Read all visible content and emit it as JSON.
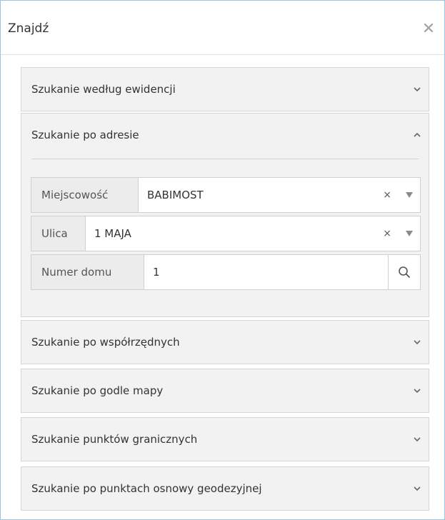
{
  "dialog": {
    "title": "Znajdź",
    "close_icon": "close-icon"
  },
  "panels": [
    {
      "title": "Szukanie według ewidencji",
      "state": "collapsed",
      "icon": "chevron-down-icon"
    },
    {
      "title": "Szukanie po adresie",
      "state": "expanded",
      "icon": "chevron-up-icon"
    },
    {
      "title": "Szukanie po współrzędnych",
      "state": "collapsed",
      "icon": "chevron-down-icon"
    },
    {
      "title": "Szukanie po godle mapy",
      "state": "collapsed",
      "icon": "chevron-down-icon"
    },
    {
      "title": "Szukanie punktów granicznych",
      "state": "collapsed",
      "icon": "chevron-down-icon"
    },
    {
      "title": "Szukanie po punktach osnowy geodezyjnej",
      "state": "collapsed",
      "icon": "chevron-down-icon"
    }
  ],
  "address_form": {
    "city": {
      "label": "Miejscowość",
      "value": "BABIMOST",
      "clear": "×"
    },
    "street": {
      "label": "Ulica",
      "value": "1 MAJA",
      "clear": "×"
    },
    "house_number": {
      "label": "Numer domu",
      "value": "1",
      "search_icon": "search-icon"
    }
  },
  "colors": {
    "dialog_border": "#9ec3df",
    "panel_bg": "#f2f2f2",
    "label_bg": "#ececec"
  }
}
